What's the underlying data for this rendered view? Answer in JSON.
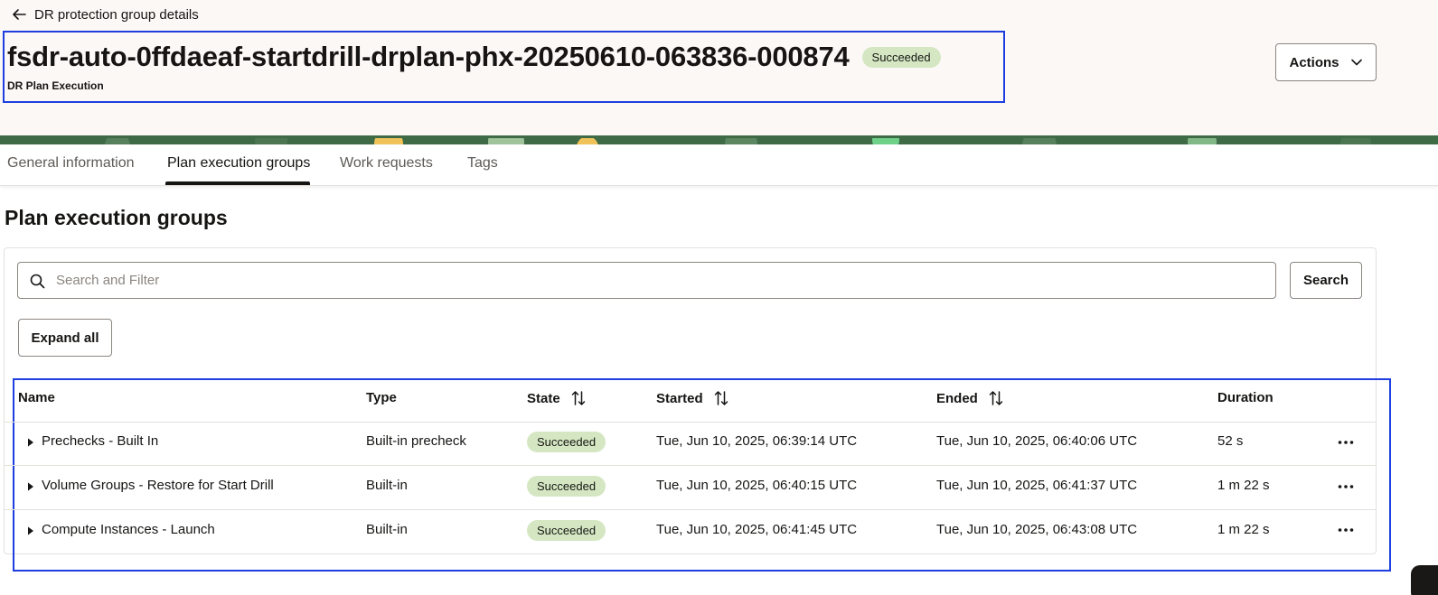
{
  "header": {
    "back_label": "DR protection group details",
    "title": "fsdr-auto-0ffdaeaf-startdrill-drplan-phx-20250610-063836-000874",
    "status": "Succeeded",
    "subtitle": "DR Plan Execution",
    "actions_label": "Actions"
  },
  "tabs": [
    {
      "label": "General information",
      "active": false
    },
    {
      "label": "Plan execution groups",
      "active": true
    },
    {
      "label": "Work requests",
      "active": false
    },
    {
      "label": "Tags",
      "active": false
    }
  ],
  "section": {
    "title": "Plan execution groups"
  },
  "search": {
    "placeholder": "Search and Filter",
    "value": "",
    "button_label": "Search"
  },
  "expand_all_label": "Expand all",
  "table": {
    "columns": [
      "Name",
      "Type",
      "State",
      "Started",
      "Ended",
      "Duration"
    ],
    "sortable_columns": [
      "State",
      "Started",
      "Ended"
    ],
    "rows": [
      {
        "name": "Prechecks - Built In",
        "type": "Built-in precheck",
        "state": "Succeeded",
        "started": "Tue, Jun 10, 2025, 06:39:14 UTC",
        "ended": "Tue, Jun 10, 2025, 06:40:06 UTC",
        "duration": "52 s"
      },
      {
        "name": "Volume Groups - Restore for Start Drill",
        "type": "Built-in",
        "state": "Succeeded",
        "started": "Tue, Jun 10, 2025, 06:40:15 UTC",
        "ended": "Tue, Jun 10, 2025, 06:41:37 UTC",
        "duration": "1 m 22 s"
      },
      {
        "name": "Compute Instances - Launch",
        "type": "Built-in",
        "state": "Succeeded",
        "started": "Tue, Jun 10, 2025, 06:41:45 UTC",
        "ended": "Tue, Jun 10, 2025, 06:43:08 UTC",
        "duration": "1 m 22 s"
      }
    ]
  },
  "colors": {
    "highlight_border": "#1f3ee0",
    "success_badge": "#d4e7c2",
    "header_bg": "#fcf8f6",
    "banner": "#3e6a46"
  },
  "icons": {
    "back": "arrow-left-icon",
    "actions": "chevron-down-icon",
    "search": "search-icon",
    "sort": "sort-icon",
    "expand_row": "caret-right-icon",
    "row_menu": "more-horizontal-icon"
  }
}
